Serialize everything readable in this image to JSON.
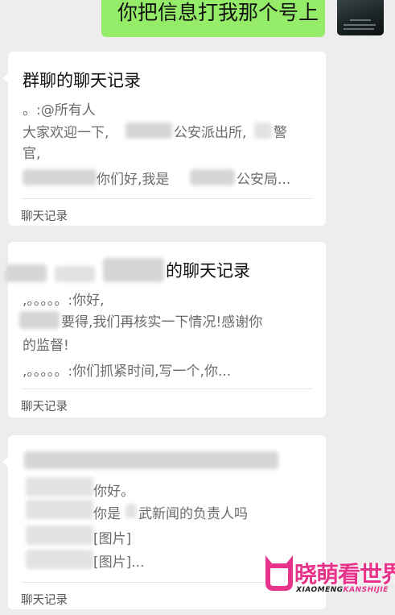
{
  "top_message": {
    "text": "你把信息打我那个号上"
  },
  "cards": [
    {
      "title": "群聊的聊天记录",
      "lines": [
        "。:@所有人",
        "大家欢迎一下,",
        "公安派出所,",
        "警",
        "官,",
        "你们好,我是",
        "公安局..."
      ],
      "footer": "聊天记录"
    },
    {
      "title": "的聊天记录",
      "lines": [
        ",。。。。。:你好,",
        "要得,我们再核实一下情况!感谢你",
        "的监督!",
        ",。。。。。:你们抓紧时间,写一个,你..."
      ],
      "footer": "聊天记录"
    },
    {
      "title": "",
      "lines": [
        "你好。",
        "你是",
        "武新闻的负责人吗",
        "[图片]",
        "[图片]..."
      ],
      "footer": "聊天记录"
    }
  ],
  "watermark": {
    "name": "晓萌看世界",
    "sub_a": "XIAOMENG",
    "sub_b": "KANSHIJIE",
    "color": "#e8338a"
  }
}
